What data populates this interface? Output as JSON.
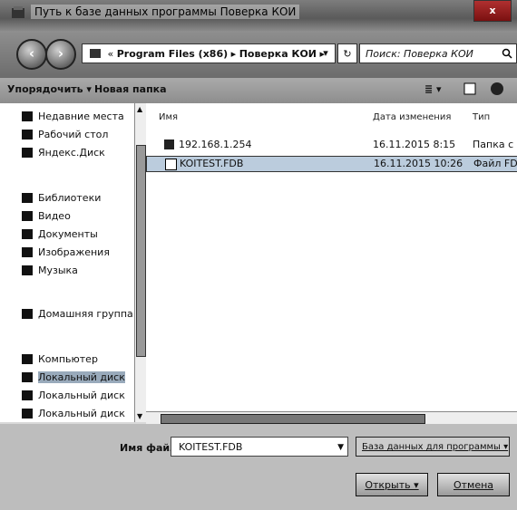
{
  "window": {
    "title": "Путь к базе данных программы Поверка КОИ",
    "close": "x"
  },
  "nav": {
    "path_prefix": "«",
    "crumb1": "Program Files (x86)",
    "sep": "▸",
    "crumb2": "Поверка КОИ",
    "search_placeholder": "Поиск: Поверка КОИ",
    "search_icon": "search-icon",
    "dropdown": "▾",
    "refresh": "↻"
  },
  "toolbar": {
    "organize": "Упорядочить ▾",
    "new_folder": "Новая папка",
    "view_icon": "≣ ▾"
  },
  "sidebar": {
    "items": [
      {
        "label": "Недавние места"
      },
      {
        "label": "Рабочий стол"
      },
      {
        "label": "Яндекс.Диск"
      },
      {
        "label": "Библиотеки"
      },
      {
        "label": "Видео"
      },
      {
        "label": "Документы"
      },
      {
        "label": "Изображения"
      },
      {
        "label": "Музыка"
      },
      {
        "label": "Домашняя группа"
      },
      {
        "label": "Компьютер"
      },
      {
        "label": "Локальный диск"
      },
      {
        "label": "Локальный диск"
      },
      {
        "label": "Локальный диск"
      }
    ]
  },
  "files": {
    "headers": {
      "name": "Имя",
      "date": "Дата изменения",
      "type": "Тип"
    },
    "rows": [
      {
        "name": "192.168.1.254",
        "date": "16.11.2015 8:15",
        "type": "Папка с фа"
      },
      {
        "name": "KOITEST.FDB",
        "date": "16.11.2015 10:26",
        "type": "Файл FDB"
      }
    ]
  },
  "footer": {
    "filename_label": "Имя файла:",
    "filename_value": "KOITEST.FDB",
    "filetype": "База данных для программы ▾",
    "open": "Открыть ▾",
    "cancel": "Отмена"
  },
  "colors": {
    "selection": "#bbccdd",
    "titlebar": "#6b6b6b"
  }
}
